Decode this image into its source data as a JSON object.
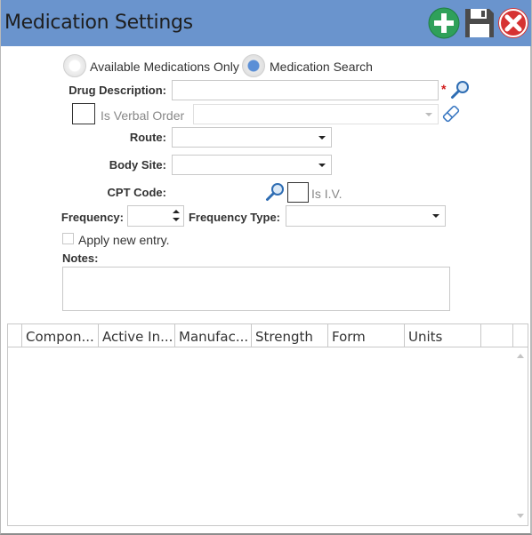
{
  "window": {
    "title": "Medication Settings"
  },
  "toolbar": {
    "add_icon": "plus-circle-icon",
    "save_icon": "floppy-disk-icon",
    "close_icon": "close-circle-icon",
    "colors": {
      "add": "#2fa05a",
      "save": "#4b4b4b",
      "close": "#d63232"
    }
  },
  "search_mode": {
    "option_available": "Available Medications Only",
    "option_search": "Medication Search",
    "selected": "Medication Search"
  },
  "form": {
    "drug_description_label": "Drug Description:",
    "drug_description_value": "",
    "required_marker": "*",
    "verbal_order_label": "Is Verbal Order",
    "verbal_order_value": "",
    "route_label": "Route:",
    "route_value": "",
    "body_site_label": "Body Site:",
    "body_site_value": "",
    "cpt_code_label": "CPT Code:",
    "is_iv_label": "Is I.V.",
    "frequency_label": "Frequency:",
    "frequency_value": "",
    "frequency_type_label": "Frequency Type:",
    "frequency_type_value": "",
    "apply_new_entry_label": "Apply new entry.",
    "notes_label": "Notes:",
    "notes_value": ""
  },
  "grid": {
    "columns": [
      "Compon...",
      "Active In...",
      "Manufac...",
      "Strength",
      "Form",
      "Units"
    ],
    "rows": []
  }
}
